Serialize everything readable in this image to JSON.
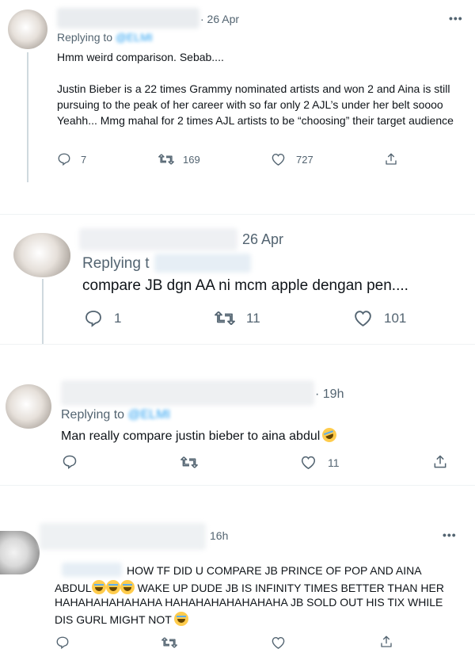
{
  "tweets": [
    {
      "time": "· 26 Apr",
      "replying_prefix": "Replying to",
      "replying_handle": "@ELMI",
      "text": "Hmm weird comparison. Sebab....\n\nJustin Bieber is a 22 times Grammy nominated artists and won 2 and Aina is still pursuing to the peak of her career with so far only 2 AJL’s under her belt soooo Yeahh... Mmg mahal for 2 times AJL artists to be “choosing” their target audience",
      "replies": "7",
      "retweets": "169",
      "likes": "727"
    },
    {
      "time": "26 Apr",
      "replying_prefix": "Replying t",
      "text": "compare JB dgn AA ni mcm apple dengan pen....",
      "replies": "1",
      "retweets": "11",
      "likes": "101"
    },
    {
      "time": "· 19h",
      "replying_prefix": "Replying to",
      "replying_handle": "@ELMI",
      "text": "Man really compare justin bieber to aina abdul",
      "replies": "",
      "retweets": "",
      "likes": "11"
    },
    {
      "time": "16h",
      "text_line1": "HOW TF DID U COMPARE JB PRINCE OF POP AND AINA",
      "text_line2a": "ABDUL",
      "text_line2b": "WAKE UP DUDE JB IS INFINITY TIMES BETTER THAN HER",
      "text_line3": "HAHAHAHAHAHAHA HAHAHAHAHAHAHAHA JB SOLD OUT HIS TIX WHILE",
      "text_line4": "DIS GURL MIGHT NOT",
      "replies": "",
      "retweets": "",
      "likes": ""
    }
  ],
  "more_label": "•••",
  "icons": [
    "reply-icon",
    "retweet-icon",
    "like-icon",
    "share-icon",
    "more-icon"
  ],
  "colors": {
    "muted": "#536471",
    "link": "#1d9bf0",
    "text": "#0f1419",
    "divider": "#eff3f4"
  }
}
